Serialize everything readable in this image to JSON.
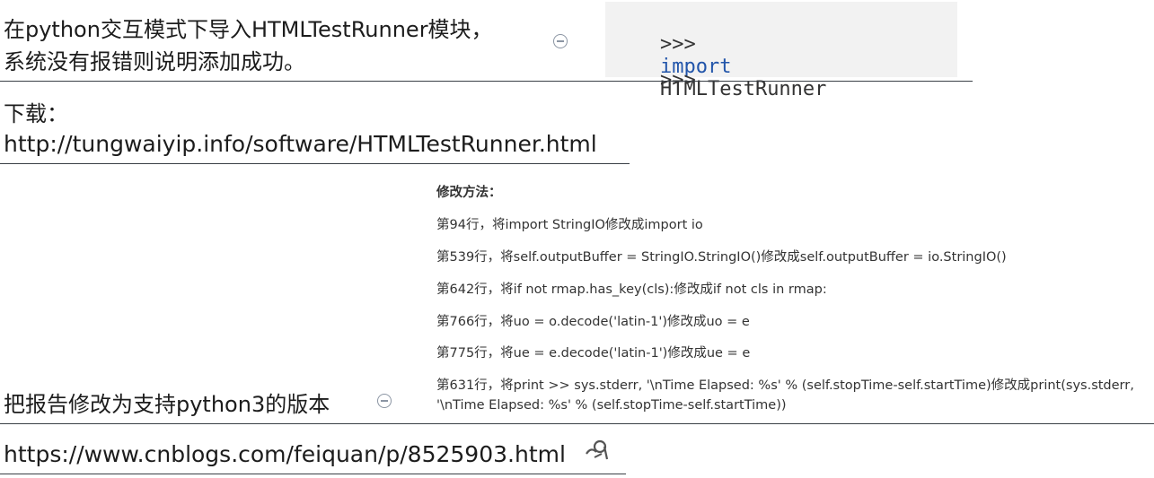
{
  "row1": {
    "text_line1": "在python交互模式下导入HTMLTestRunner模块，",
    "text_line2": "系统没有报错则说明添加成功。",
    "code": {
      "prompt1": ">>>",
      "keyword": "import",
      "module": "HTMLTestRunner",
      "prompt2": ">>>"
    }
  },
  "row2": {
    "label": "下载：",
    "url": "http://tungwaiyip.info/software/HTMLTestRunner.html"
  },
  "row3": {
    "text": "把报告修改为支持python3的版本",
    "steps_title": "修改方法：",
    "steps": [
      "第94行，将import StringIO修改成import io",
      "第539行，将self.outputBuffer = StringIO.StringIO()修改成self.outputBuffer = io.StringIO()",
      "第642行，将if not rmap.has_key(cls):修改成if not cls in rmap:",
      "第766行，将uo = o.decode('latin-1')修改成uo = e",
      "第775行，将ue = e.decode('latin-1')修改成ue = e",
      "第631行，将print >> sys.stderr, '\\nTime Elapsed: %s' % (self.stopTime-self.startTime)修改成print(sys.stderr,",
      "'\\nTime Elapsed: %s' % (self.stopTime-self.startTime))"
    ]
  },
  "row4": {
    "url": "https://www.cnblogs.com/feiquan/p/8525903.html"
  },
  "icons": {
    "collapse": "collapse-icon",
    "link": "link-icon"
  }
}
